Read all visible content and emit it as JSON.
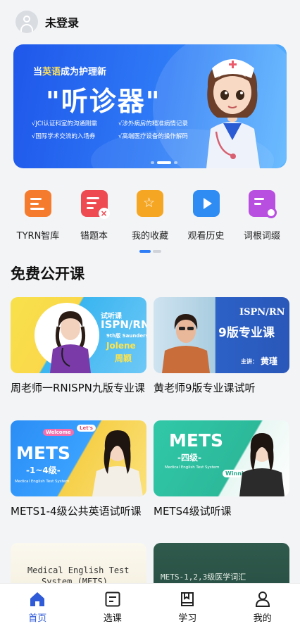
{
  "header": {
    "user_label": "未登录"
  },
  "banner": {
    "line1_a": "当",
    "line1_hl": "英语",
    "line1_b": "成为护理新",
    "title": "\"听诊器\"",
    "bullets": [
      "√JCI认证科室的沟通刚需",
      "√涉外病房的精准病情记录",
      "√国际学术交流的入场券",
      "√高端医疗设备的操作解码"
    ],
    "accent_color": "#ffe15a"
  },
  "entries": [
    {
      "label": "TYRN智库",
      "icon": "notebook-pen-icon"
    },
    {
      "label": "错题本",
      "icon": "wrong-book-icon"
    },
    {
      "label": "我的收藏",
      "icon": "star-folder-icon"
    },
    {
      "label": "观看历史",
      "icon": "play-tv-icon"
    },
    {
      "label": "词根词缀",
      "icon": "clipboard-search-icon"
    }
  ],
  "section": {
    "title": "免费公开课"
  },
  "courses": [
    {
      "title": "周老师一RNISPN九版专业课",
      "thumb_text_1": "试听课",
      "thumb_text_2": "ISPN/RN",
      "thumb_text_3": "9th版 Saunders",
      "thumb_text_4": "Jolene",
      "thumb_text_5": "周颖"
    },
    {
      "title": "黄老师9版专业课试听",
      "thumb_text_1": "ISPN/RN",
      "thumb_text_2": "9版专业课",
      "thumb_text_3": "主讲：",
      "thumb_text_4": "黄瑾"
    },
    {
      "title": "METS1-4级公共英语试听课",
      "thumb_text_1": "METS",
      "thumb_text_2": "-1~4级-",
      "thumb_text_3": "Medical English Test System",
      "thumb_text_4": "Welcome",
      "thumb_text_5": "Let's"
    },
    {
      "title": "METS4级试听课",
      "thumb_text_1": "METS",
      "thumb_text_2": "-四级-",
      "thumb_text_3": "Medical English Test System",
      "thumb_text_4": "Winnie"
    },
    {
      "title": "",
      "thumb_text_1": "Medical English Test",
      "thumb_text_2": "System (METS)"
    },
    {
      "title": "",
      "thumb_text_1": "METS-1,2,3级医学词汇"
    }
  ],
  "tabbar": [
    {
      "label": "首页",
      "icon": "home-icon",
      "active": true
    },
    {
      "label": "选课",
      "icon": "course-list-icon",
      "active": false
    },
    {
      "label": "学习",
      "icon": "book-icon",
      "active": false
    },
    {
      "label": "我的",
      "icon": "user-icon",
      "active": false
    }
  ],
  "colors": {
    "primary": "#2f5bd8",
    "banner": "#2f7cf7"
  }
}
